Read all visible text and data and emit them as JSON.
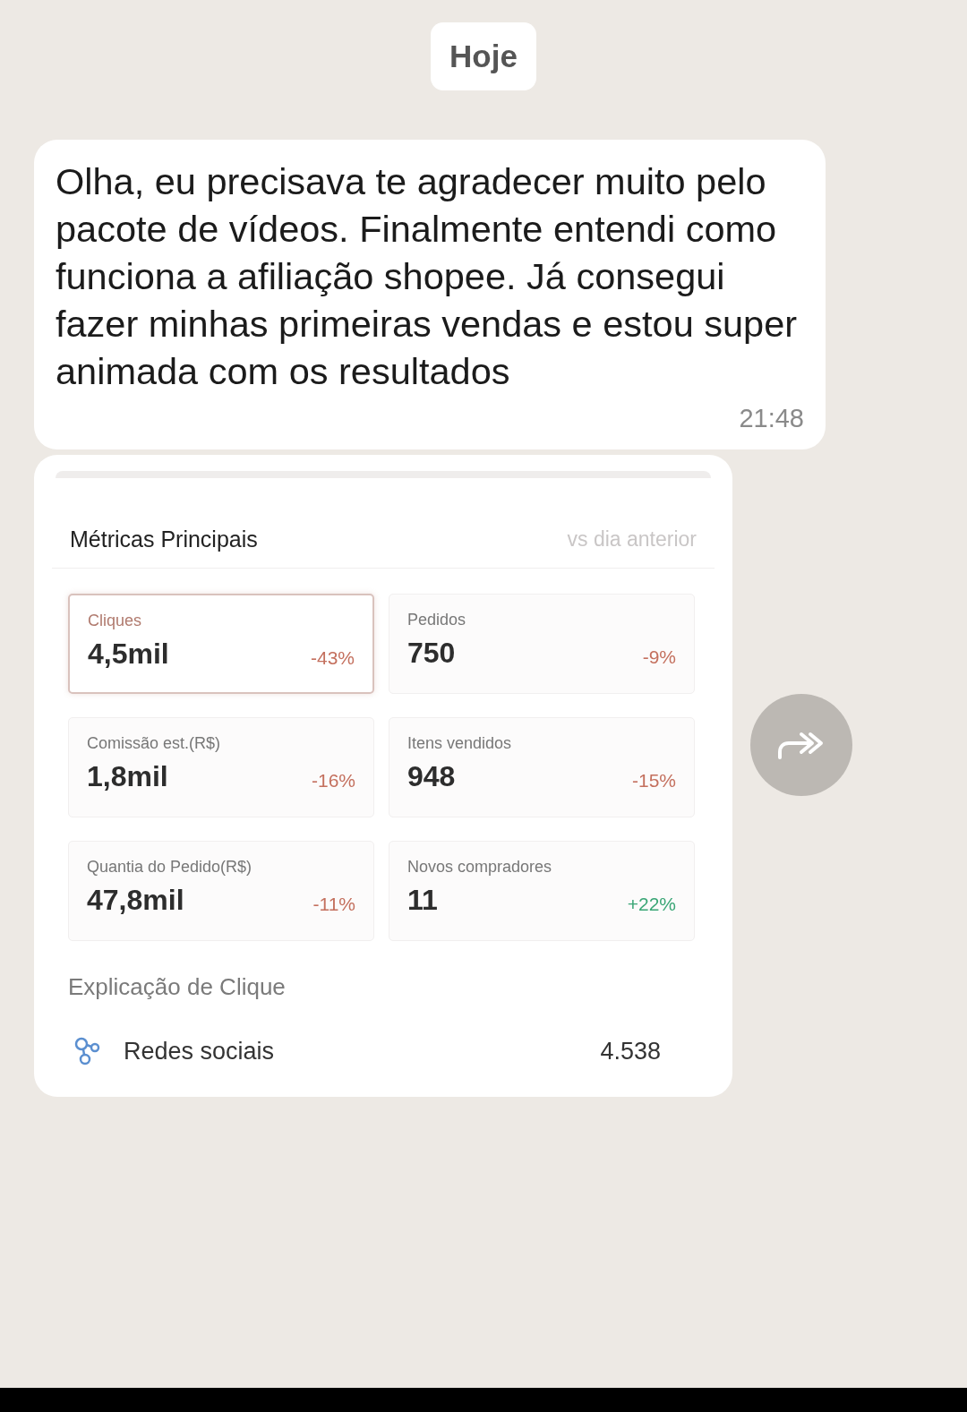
{
  "date_chip": "Hoje",
  "message": {
    "text": "Olha, eu precisava te agradecer muito pelo pacote de vídeos. Finalmente entendi como funciona a afiliação shopee. Já consegui fazer minhas primeiras vendas e estou super animada com os resultados",
    "time": "21:48"
  },
  "screenshot": {
    "title": "Métricas Principais",
    "comparison": "vs dia anterior",
    "metrics": [
      {
        "label": "Cliques",
        "value": "4,5mil",
        "change": "-43%",
        "color": "#c4705e",
        "selected": true
      },
      {
        "label": "Pedidos",
        "value": "750",
        "change": "-9%",
        "color": "#c4705e",
        "selected": false
      },
      {
        "label": "Comissão est.(R$)",
        "value": "1,8mil",
        "change": "-16%",
        "color": "#c4705e",
        "selected": false
      },
      {
        "label": "Itens vendidos",
        "value": "948",
        "change": "-15%",
        "color": "#c4705e",
        "selected": false
      },
      {
        "label": "Quantia do Pedido(R$)",
        "value": "47,8mil",
        "change": "-11%",
        "color": "#c4705e",
        "selected": false
      },
      {
        "label": "Novos compradores",
        "value": "11",
        "change": "+22%",
        "color": "#3aa676",
        "selected": false
      }
    ],
    "section_title": "Explicação de Clique",
    "sources": [
      {
        "name": "Redes sociais",
        "count": "4.538"
      }
    ]
  }
}
